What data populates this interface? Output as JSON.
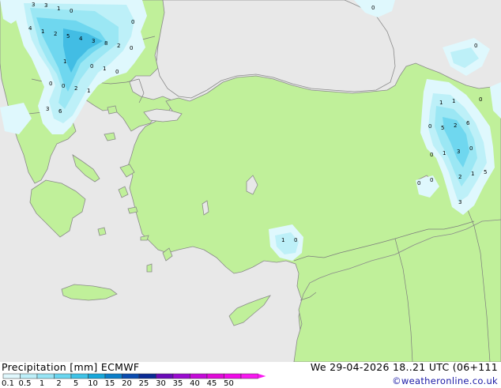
{
  "map": {
    "region": "Eastern Mediterranean / Turkey",
    "sea_color": "#e8e8e8",
    "land_color": "#c0f09a",
    "border_color": "#8a8a8a",
    "precip_colors": [
      "#dff8fd",
      "#bdf0f8",
      "#9be7f4",
      "#6fd7ef",
      "#42bde4"
    ],
    "point_labels": [
      {
        "id": "p1",
        "text": "3"
      },
      {
        "id": "p2",
        "text": "3"
      },
      {
        "id": "p3",
        "text": "1"
      },
      {
        "id": "p4",
        "text": "0"
      },
      {
        "id": "p5",
        "text": "4"
      },
      {
        "id": "p6",
        "text": "1"
      },
      {
        "id": "p7",
        "text": "2"
      },
      {
        "id": "p8",
        "text": "5"
      },
      {
        "id": "p9",
        "text": "4"
      },
      {
        "id": "p10",
        "text": "3"
      },
      {
        "id": "p11",
        "text": "8"
      },
      {
        "id": "p12",
        "text": "2"
      },
      {
        "id": "p13",
        "text": "0"
      },
      {
        "id": "p14",
        "text": "1"
      },
      {
        "id": "p15",
        "text": "0"
      },
      {
        "id": "p16",
        "text": "1"
      },
      {
        "id": "p17",
        "text": "0"
      },
      {
        "id": "p18",
        "text": "0"
      },
      {
        "id": "p19",
        "text": "0"
      },
      {
        "id": "p20",
        "text": "2"
      },
      {
        "id": "p21",
        "text": "1"
      },
      {
        "id": "p22",
        "text": "3"
      },
      {
        "id": "p23",
        "text": "6"
      },
      {
        "id": "p24",
        "text": "0"
      },
      {
        "id": "p25",
        "text": "0"
      },
      {
        "id": "p26",
        "text": "0"
      },
      {
        "id": "p27",
        "text": "1"
      },
      {
        "id": "p28",
        "text": "1"
      },
      {
        "id": "p29",
        "text": "0"
      },
      {
        "id": "p30",
        "text": "5"
      },
      {
        "id": "p31",
        "text": "2"
      },
      {
        "id": "p32",
        "text": "6"
      },
      {
        "id": "p33",
        "text": "0"
      },
      {
        "id": "p34",
        "text": "1"
      },
      {
        "id": "p35",
        "text": "3"
      },
      {
        "id": "p36",
        "text": "0"
      },
      {
        "id": "p37",
        "text": "0"
      },
      {
        "id": "p38",
        "text": "2"
      },
      {
        "id": "p39",
        "text": "1"
      },
      {
        "id": "p40",
        "text": "5"
      },
      {
        "id": "p41",
        "text": "0"
      },
      {
        "id": "p42",
        "text": "0"
      },
      {
        "id": "p43",
        "text": "3"
      },
      {
        "id": "p44",
        "text": "1"
      },
      {
        "id": "p45",
        "text": "0"
      }
    ]
  },
  "footer": {
    "title": "Precipitation [mm]  ECMWF",
    "valid": "We 29-04-2026 18..21 UTC (06+111",
    "credit": "©weatheronline.co.uk"
  },
  "legend": {
    "ticks": [
      "0.1",
      "0.5",
      "1",
      "2",
      "5",
      "10",
      "15",
      "20",
      "25",
      "30",
      "35",
      "40",
      "45",
      "50"
    ],
    "colors": [
      "#e0f8fd",
      "#bdeff9",
      "#97e4f5",
      "#6ad6f0",
      "#3fc3e7",
      "#17a7da",
      "#0b7ec8",
      "#0a4cb0",
      "#0a2a95",
      "#6a0ab8",
      "#9a0ad0",
      "#c40ad8",
      "#e00ad8",
      "#f00ae8",
      "#f818f0"
    ]
  }
}
